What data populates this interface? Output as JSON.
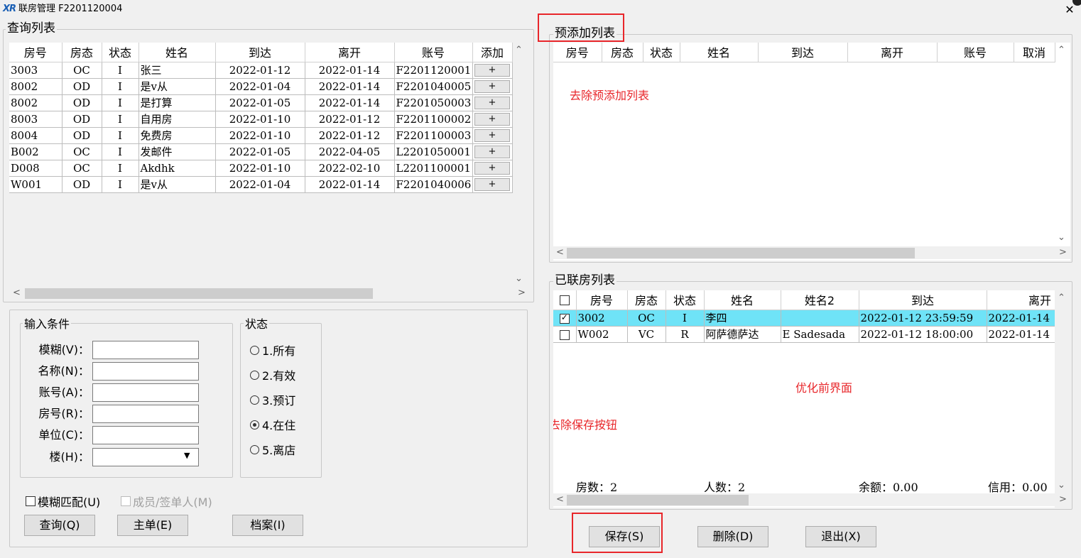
{
  "window": {
    "title": "联房管理 F2201120004",
    "logo": "XR"
  },
  "query": {
    "title": "查询列表",
    "columns": [
      "房号",
      "房态",
      "状态",
      "姓名",
      "到达",
      "离开",
      "账号",
      "添加"
    ],
    "rows": [
      {
        "room": "3003",
        "rstate": "OC",
        "status": "I",
        "name": "张三",
        "arrive": "2022-01-12",
        "depart": "2022-01-14",
        "account": "F2201120001",
        "add": "+"
      },
      {
        "room": "8002",
        "rstate": "OD",
        "status": "I",
        "name": "是v从",
        "arrive": "2022-01-04",
        "depart": "2022-01-14",
        "account": "F2201040005",
        "add": "+"
      },
      {
        "room": "8002",
        "rstate": "OD",
        "status": "I",
        "name": "是打算",
        "arrive": "2022-01-05",
        "depart": "2022-01-14",
        "account": "F2201050003",
        "add": "+"
      },
      {
        "room": "8003",
        "rstate": "OD",
        "status": "I",
        "name": "自用房",
        "arrive": "2022-01-10",
        "depart": "2022-01-12",
        "account": "F2201100002",
        "add": "+"
      },
      {
        "room": "8004",
        "rstate": "OD",
        "status": "I",
        "name": "免费房",
        "arrive": "2022-01-10",
        "depart": "2022-01-12",
        "account": "F2201100003",
        "add": "+"
      },
      {
        "room": "B002",
        "rstate": "OC",
        "status": "I",
        "name": "发邮件",
        "arrive": "2022-01-05",
        "depart": "2022-04-05",
        "account": "L2201050001",
        "add": "+"
      },
      {
        "room": "D008",
        "rstate": "OC",
        "status": "I",
        "name": "Akdhk",
        "arrive": "2022-01-10",
        "depart": "2022-02-10",
        "account": "L2201100001",
        "add": "+"
      },
      {
        "room": "W001",
        "rstate": "OD",
        "status": "I",
        "name": "是v从",
        "arrive": "2022-01-04",
        "depart": "2022-01-14",
        "account": "F2201040006",
        "add": "+"
      }
    ]
  },
  "conditions": {
    "title": "输入条件",
    "fuzzy_label": "模糊(V)：",
    "name_label": "名称(N)：",
    "account_label": "账号(A)：",
    "room_label": "房号(R)：",
    "unit_label": "单位(C)：",
    "building_label": "楼(H)：",
    "fuzzy_value": "",
    "name_value": "",
    "account_value": "",
    "room_value": "",
    "unit_value": "",
    "building_value": ""
  },
  "status_group": {
    "title": "状态",
    "options": [
      "1.所有",
      "2.有效",
      "3.预订",
      "4.在住",
      "5.离店"
    ],
    "selected": "4.在住"
  },
  "checks": {
    "fuzzy_match": "模糊匹配(U)",
    "member": "成员/签单人(M)"
  },
  "left_buttons": {
    "query": "查询(Q)",
    "main": "主单(E)",
    "archive": "档案(I)"
  },
  "preadd": {
    "title": "预添加列表",
    "columns": [
      "房号",
      "房态",
      "状态",
      "姓名",
      "到达",
      "离开",
      "账号",
      "取消"
    ],
    "note": "去除预添加列表"
  },
  "linked": {
    "title": "已联房列表",
    "columns": [
      "",
      "房号",
      "房态",
      "状态",
      "姓名",
      "姓名2",
      "到达",
      "离开"
    ],
    "rows": [
      {
        "checked": true,
        "room": "3002",
        "rstate": "OC",
        "status": "I",
        "name": "李四",
        "name2": "",
        "arrive": "2022-01-12 23:59:59",
        "depart": "2022-01-14"
      },
      {
        "checked": false,
        "room": "W002",
        "rstate": "VC",
        "status": "R",
        "name": "阿萨德萨达",
        "name2": "E Sadesada",
        "arrive": "2022-01-12 18:00:00",
        "depart": "2022-01-14"
      }
    ],
    "note_opt": "优化前界面",
    "note_save": "去除保存按钮",
    "summary": {
      "rooms": "房数：2",
      "people": "人数：2",
      "balance": "余额：0.00",
      "credit": "信用：0.00"
    }
  },
  "bottom_buttons": {
    "save": "保存(S)",
    "delete": "删除(D)",
    "exit": "退出(X)"
  },
  "colors": {
    "highlight": "#e8262a",
    "selected_row": "#6fe3f7"
  }
}
